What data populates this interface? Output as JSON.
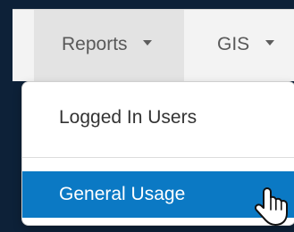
{
  "nav": {
    "items": [
      {
        "label": "Reports",
        "has_caret": true,
        "active": true
      },
      {
        "label": "GIS",
        "has_caret": true,
        "active": false
      }
    ]
  },
  "dropdown": {
    "items": [
      {
        "label": "Logged In Users",
        "active": false
      },
      {
        "label": "General Usage",
        "active": true
      }
    ]
  },
  "colors": {
    "background": "#0d2138",
    "navbar": "#f3f3f3",
    "active_nav": "#e3e3e3",
    "active_menu": "#0b79c4"
  },
  "icons": {
    "reports_caret": "caret-down-icon",
    "gis_caret": "caret-down-icon",
    "cursor": "hand-pointer-icon"
  }
}
